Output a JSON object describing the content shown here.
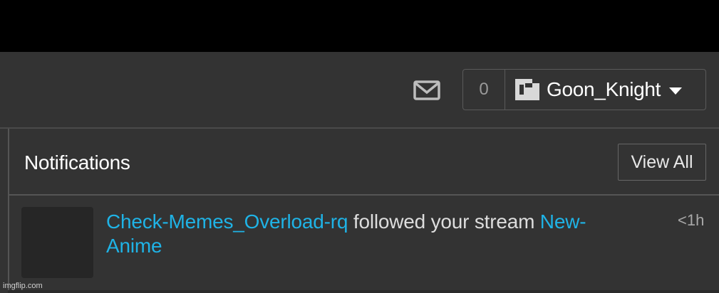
{
  "header": {
    "mail_icon": "envelope-icon",
    "notification_count": "0",
    "user_logo_icon": "user-logo-icon",
    "username": "Goon_Knight",
    "dropdown_icon": "caret-down-icon"
  },
  "notifications": {
    "title": "Notifications",
    "view_all_label": "View All",
    "items": [
      {
        "actor": "Check-Memes_Overload-rq",
        "action": " followed your stream ",
        "target_line1": "New-",
        "target_line2": "Anime",
        "time": "<1h"
      }
    ]
  },
  "watermark": "imgflip.com",
  "colors": {
    "background": "#333333",
    "link": "#1fb3e6",
    "text": "#dddddd"
  }
}
